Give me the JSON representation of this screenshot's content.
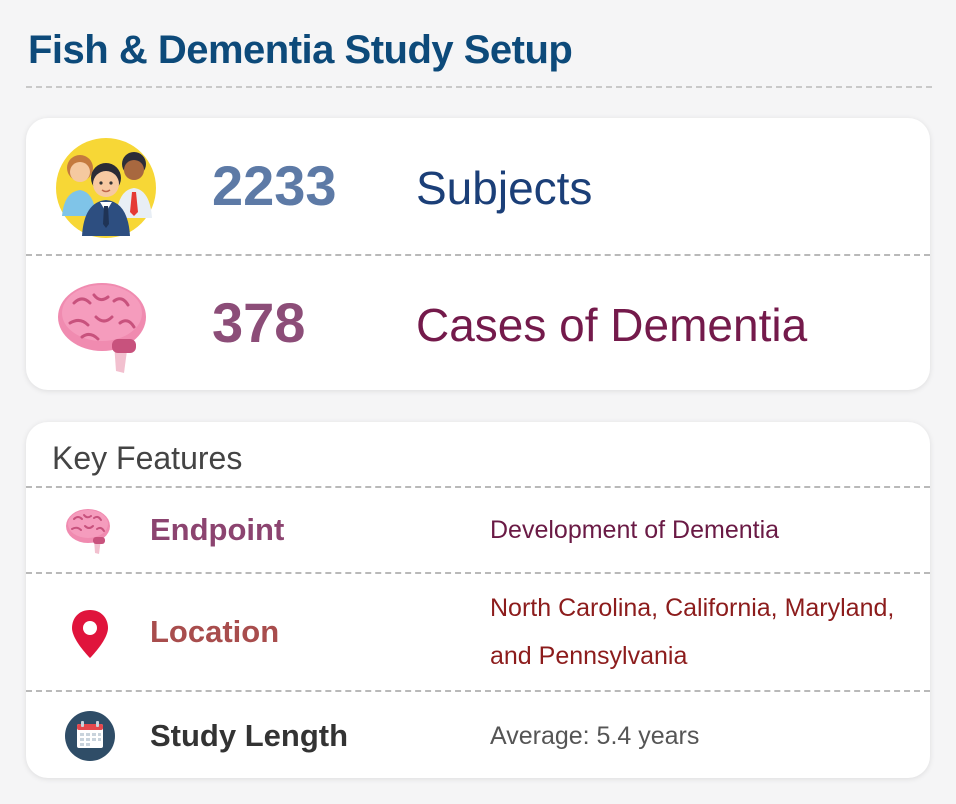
{
  "header": {
    "title": "Fish & Dementia Study Setup"
  },
  "stats": [
    {
      "icon": "people-group-icon",
      "value": "2233",
      "label": "Subjects",
      "value_color": "#5d7aa6",
      "label_color": "#1b3f78"
    },
    {
      "icon": "brain-icon",
      "value": "378",
      "label": "Cases of Dementia",
      "value_color": "#8c4d78",
      "label_color": "#741a4b"
    }
  ],
  "features": {
    "title": "Key Features",
    "rows": [
      {
        "icon": "brain-icon",
        "label": "Endpoint",
        "value": "Development of Dementia"
      },
      {
        "icon": "location-pin-icon",
        "label": "Location",
        "value": "North Carolina, California, Maryland, and Pennsylvania"
      },
      {
        "icon": "calendar-icon",
        "label": "Study Length",
        "value": "Average: 5.4 years"
      }
    ]
  },
  "colors": {
    "title": "#0d4a7a",
    "pin": "#e0143c",
    "brain": "#f08bb0"
  }
}
